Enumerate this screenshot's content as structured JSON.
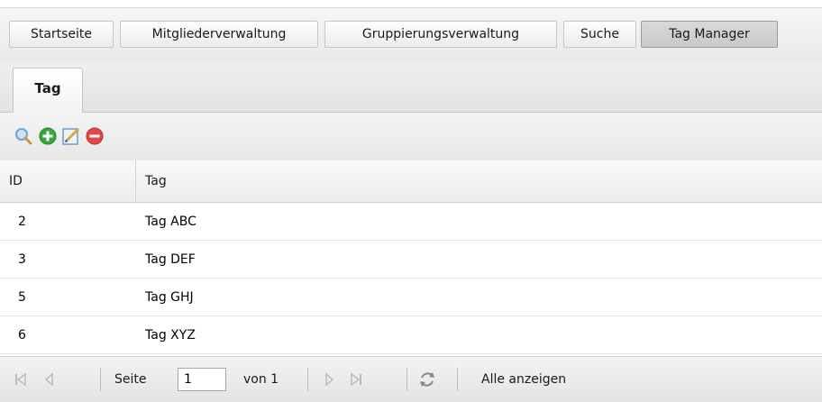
{
  "main_tabs": [
    {
      "label": "Startseite",
      "active": false
    },
    {
      "label": "Mitgliederverwaltung",
      "active": false
    },
    {
      "label": "Gruppierungsverwaltung",
      "active": false
    },
    {
      "label": "Suche",
      "active": false
    },
    {
      "label": "Tag Manager",
      "active": true
    }
  ],
  "sub_tab": {
    "label": "Tag"
  },
  "toolbar": {
    "icons": [
      "search-icon",
      "add-icon",
      "edit-icon",
      "delete-icon"
    ],
    "colors": {
      "add": "#3aa63a",
      "delete": "#e04848",
      "search": "#6fa3d8"
    }
  },
  "grid": {
    "columns": [
      "ID",
      "Tag"
    ],
    "rows": [
      {
        "id": "2",
        "tag": "Tag ABC"
      },
      {
        "id": "3",
        "tag": "Tag DEF"
      },
      {
        "id": "5",
        "tag": "Tag GHJ"
      },
      {
        "id": "6",
        "tag": "Tag XYZ"
      }
    ]
  },
  "pager": {
    "page_label": "Seite",
    "page_value": "1",
    "of_label": "von 1",
    "show_all": "Alle anzeigen"
  }
}
